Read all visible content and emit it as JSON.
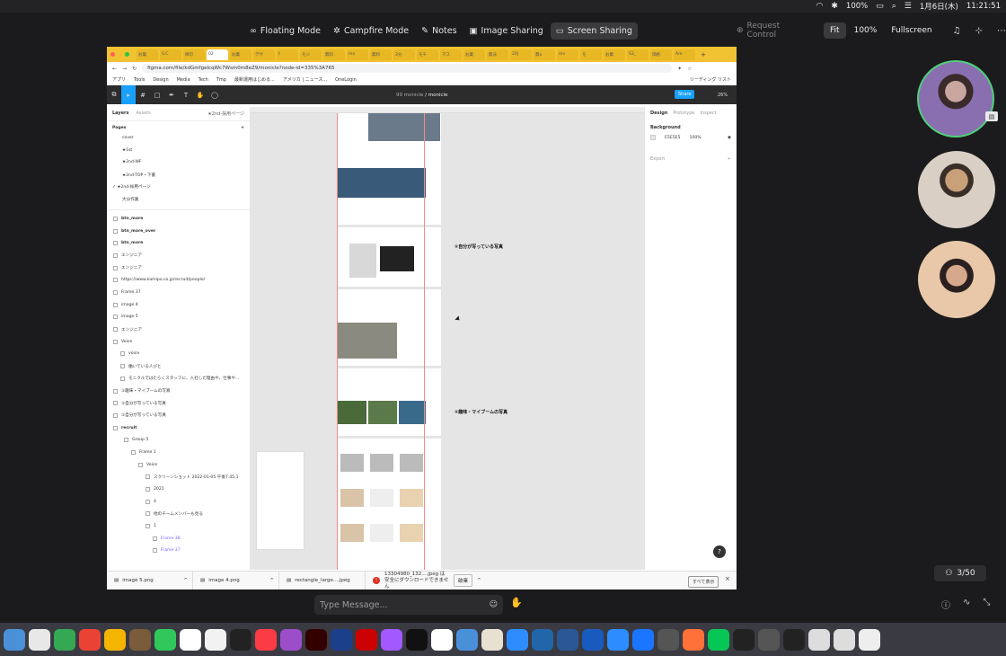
{
  "menubar": {
    "battery": "100%",
    "date": "1月6日(木)",
    "time": "11:21:51"
  },
  "modes": [
    {
      "label": "Floating Mode",
      "icon": "link-icon"
    },
    {
      "label": "Campfire Mode",
      "icon": "gear-icon"
    },
    {
      "label": "Notes",
      "icon": "note-icon"
    },
    {
      "label": "Image Sharing",
      "icon": "image-icon"
    },
    {
      "label": "Screen Sharing",
      "icon": "monitor-icon",
      "active": true
    }
  ],
  "right": {
    "request_control": "Request Control",
    "fit": "Fit",
    "zoom": "100%",
    "fullscreen": "Fullscreen"
  },
  "browser": {
    "url": "figma.com/file/kdGmfgeIcqWc7Wsm0m8eZ9/monicle?node-id=335%3A765",
    "bookmarks": [
      "アプリ",
      "Tools",
      "Design",
      "Media",
      "Tech",
      "Tmp",
      "最新運用はじめる...",
      "アメリカ | ニュース...",
      "OneLogin"
    ],
    "reading_list": "リーディング リスト",
    "tabs": [
      "お菓",
      "S.C",
      "締切",
      "02",
      "お菓",
      "デザ",
      "t",
      "モジ",
      "無料",
      "mo",
      "無料",
      "3分",
      "モチ",
      "マス",
      "お菓",
      "無法",
      "20J",
      "無o",
      "mo",
      "モ",
      "お菓",
      "S3_",
      "価格",
      "Am"
    ]
  },
  "figma": {
    "file": "monicle",
    "project": "99 monicle",
    "share": "Share",
    "zoom": "26%"
  },
  "layers_panel": {
    "tab_layers": "Layers",
    "tab_assets": "Assets",
    "current_page": "★2nd-採用ページ",
    "pages_title": "Pages",
    "pages": [
      "cover",
      "★1st",
      "★2nd-WF",
      "★2nd-TOP・下書",
      "★2nd-採用ページ",
      "大分作業"
    ],
    "layers": [
      {
        "t": "btn_more",
        "b": true
      },
      {
        "t": "btn_more_over",
        "b": true
      },
      {
        "t": "btn_more",
        "b": true
      },
      {
        "t": "エンジニア"
      },
      {
        "t": "エンジニア"
      },
      {
        "t": "https://www.kamipo.co.jp/recruit/people/"
      },
      {
        "t": "Frame 37"
      },
      {
        "t": "image 4"
      },
      {
        "t": "image 5"
      },
      {
        "t": "エンジニア"
      },
      {
        "t": "Voice"
      },
      {
        "t": "voice"
      },
      {
        "t": "働いている人びと"
      },
      {
        "t": "モニクルではたらくスタッフに、入社した理由や、仕事や..."
      },
      {
        "t": "①趣味・マイブームの写真"
      },
      {
        "t": "①自分が写っている写真"
      },
      {
        "t": "①自分が写っている写真"
      },
      {
        "t": "recruit",
        "b": true
      },
      {
        "t": "Group 5"
      },
      {
        "t": "Frame 1"
      },
      {
        "t": "Voice"
      },
      {
        "t": "スクリーンショット 2022-01-05 午後7.45.1"
      },
      {
        "t": "2021"
      },
      {
        "t": "4"
      },
      {
        "t": "他のチームメンバーも見る"
      },
      {
        "t": "1"
      },
      {
        "t": "Frame 38",
        "p": true
      },
      {
        "t": "Frame 37",
        "p": true
      }
    ]
  },
  "props": {
    "tab_design": "Design",
    "tab_prototype": "Prototype",
    "tab_inspect": "Inspect",
    "background": "Background",
    "bg_hex": "E5E5E5",
    "bg_opacity": "100%",
    "export": "Export"
  },
  "canvas": {
    "caption1": "①自分が写っている写真",
    "caption2": "①趣味・マイブームの写真"
  },
  "downloads": {
    "items": [
      "image 5.png",
      "image 4.png",
      "rectangle_large....jpeg"
    ],
    "warn_file": "13304980_132....jpeg は安全にダウンロードできません",
    "warn_btn": "破棄",
    "show_all": "すべて表示"
  },
  "participants": "3/50",
  "message_placeholder": "Type Message...",
  "colors": {
    "chrome_tab_bar": "#f1c232",
    "figma_toolbar": "#2c2c2c",
    "figma_blue": "#18a0fb",
    "active_speaker": "#4fd07c"
  }
}
